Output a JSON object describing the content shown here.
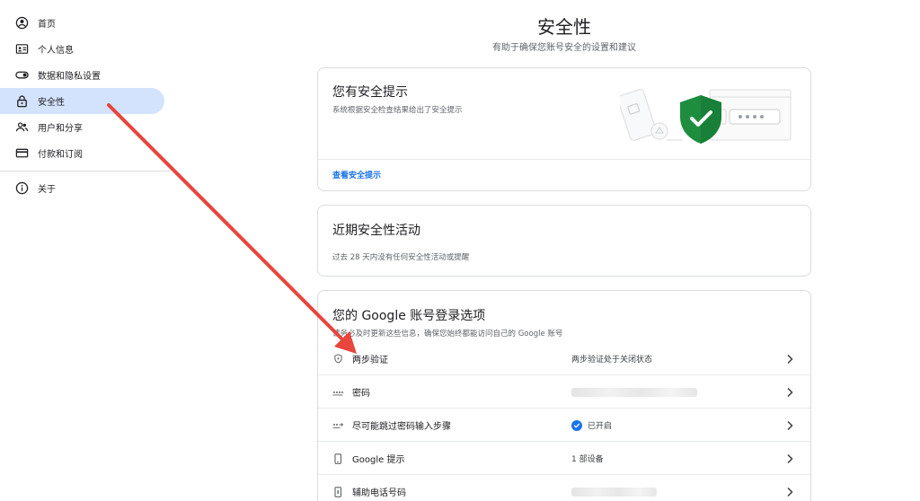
{
  "sidebar": {
    "items": [
      {
        "label": "首页",
        "icon": "account-circle-icon",
        "active": false
      },
      {
        "label": "个人信息",
        "icon": "id-card-icon",
        "active": false
      },
      {
        "label": "数据和隐私设置",
        "icon": "toggle-icon",
        "active": false
      },
      {
        "label": "安全性",
        "icon": "lock-icon",
        "active": true
      },
      {
        "label": "用户和分享",
        "icon": "people-icon",
        "active": false
      },
      {
        "label": "付款和订阅",
        "icon": "credit-card-icon",
        "active": false
      },
      {
        "label": "关于",
        "icon": "info-icon",
        "active": false
      }
    ]
  },
  "header": {
    "title": "安全性",
    "subtitle": "有助于确保您账号安全的设置和建议"
  },
  "security_tips": {
    "title": "您有安全提示",
    "desc": "系统根据安全检查结果给出了安全提示",
    "link": "查看安全提示"
  },
  "recent_activity": {
    "title": "近期安全性活动",
    "desc": "过去 28 天内没有任何安全性活动或提醒"
  },
  "signin": {
    "title": "您的 Google 账号登录选项",
    "desc": "请务必及时更新这些信息，确保您始终都能访问自己的 Google 账号",
    "rows": [
      {
        "label": "两步验证",
        "icon": "shield-icon",
        "value": "两步验证处于关闭状态"
      },
      {
        "label": "密码",
        "icon": "password-dots-icon",
        "value": ""
      },
      {
        "label": "尽可能跳过密码输入步骤",
        "icon": "passkey-icon",
        "value": "已开启"
      },
      {
        "label": "Google 提示",
        "icon": "phone-icon",
        "value": "1 部设备"
      },
      {
        "label": "辅助电话号码",
        "icon": "phone-number-icon",
        "value": ""
      }
    ]
  },
  "colors": {
    "accent": "#1a73e8",
    "active_nav": "#d3e3fd",
    "shield_green": "#1e8e3e",
    "annotation_arrow": "#e8453c"
  }
}
